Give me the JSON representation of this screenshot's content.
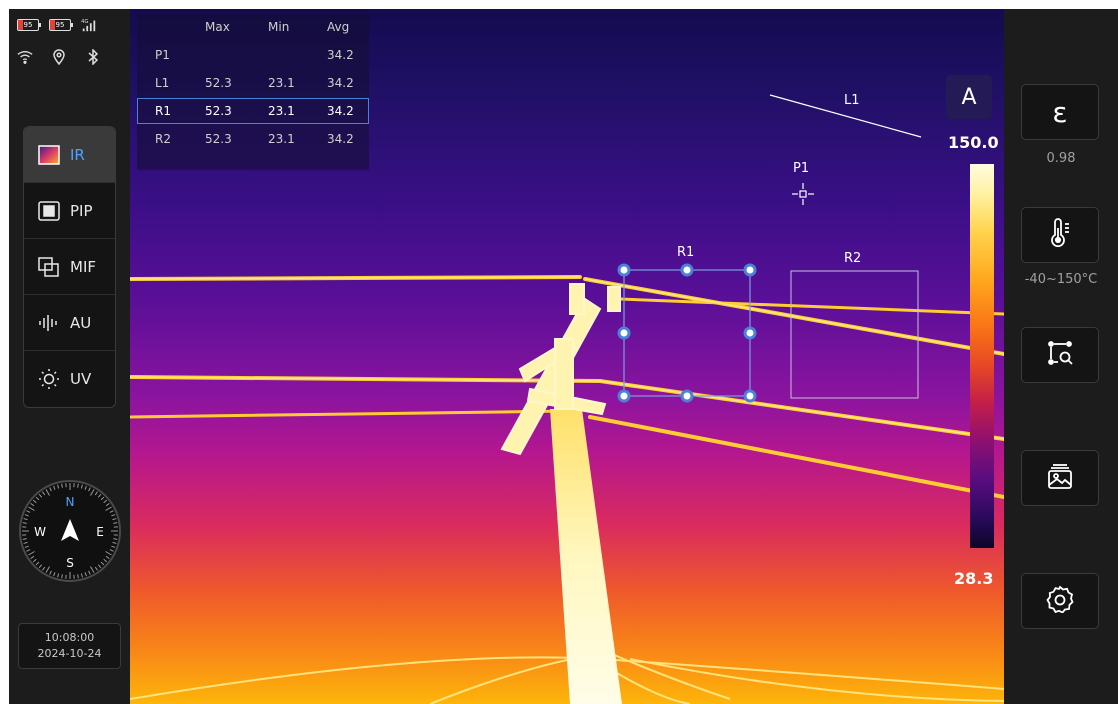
{
  "status": {
    "battery1": "95",
    "battery2": "95",
    "network": "4G"
  },
  "modes": [
    {
      "label": "IR",
      "active": true
    },
    {
      "label": "PIP",
      "active": false
    },
    {
      "label": "MIF",
      "active": false
    },
    {
      "label": "AU",
      "active": false
    },
    {
      "label": "UV",
      "active": false
    }
  ],
  "compass": {
    "n": "N",
    "s": "S",
    "e": "E",
    "w": "W"
  },
  "clock": {
    "time": "10:08:00",
    "date": "2024-10-24"
  },
  "measurements": {
    "headers": [
      "Max",
      "Min",
      "Avg"
    ],
    "rows": [
      {
        "name": "P1",
        "max": "",
        "min": "",
        "avg": "34.2",
        "selected": false
      },
      {
        "name": "L1",
        "max": "52.3",
        "min": "23.1",
        "avg": "34.2",
        "selected": false
      },
      {
        "name": "R1",
        "max": "52.3",
        "min": "23.1",
        "avg": "34.2",
        "selected": true
      },
      {
        "name": "R2",
        "max": "52.3",
        "min": "23.1",
        "avg": "34.2",
        "selected": false
      }
    ]
  },
  "overlays": {
    "l1": "L1",
    "p1": "P1",
    "r1": "R1",
    "r2": "R2"
  },
  "scale": {
    "mode": "A",
    "max": "150.0",
    "min": "28.3"
  },
  "right": {
    "emissivity_symbol": "ε",
    "emissivity": "0.98",
    "temp_range": "-40~150°C"
  },
  "colors": {
    "accent": "#4aa3ff",
    "selection": "#4a82d8",
    "handle": "#7ab0ff"
  }
}
